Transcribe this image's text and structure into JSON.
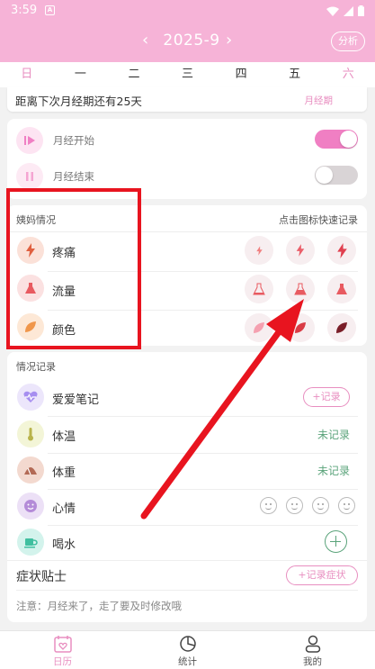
{
  "status_bar": {
    "time": "3:59",
    "app_icon_letter": "A"
  },
  "header": {
    "month": "2025-9",
    "prev": "‹",
    "next": "›",
    "analyze_label": "分析"
  },
  "weekdays": [
    "日",
    "一",
    "二",
    "三",
    "四",
    "五",
    "六"
  ],
  "countdown": {
    "text": "距离下次月经期还有25天",
    "badge": "月经期"
  },
  "period_toggles": [
    {
      "label": "月经开始",
      "on": true
    },
    {
      "label": "月经结束",
      "on": false
    }
  ],
  "aunt_section": {
    "title": "姨妈情况",
    "hint": "点击图标快速记录",
    "rows": [
      {
        "label": "疼痛",
        "icon": "lightning-icon"
      },
      {
        "label": "流量",
        "icon": "flask-icon"
      },
      {
        "label": "颜色",
        "icon": "leaf-icon"
      }
    ]
  },
  "records": {
    "title": "情况记录",
    "items": [
      {
        "label": "爱爱笔记",
        "action": "+记录",
        "icon": "heart-pulse-icon"
      },
      {
        "label": "体温",
        "action": "未记录",
        "icon": "thermometer-icon"
      },
      {
        "label": "体重",
        "action": "未记录",
        "icon": "scale-icon"
      },
      {
        "label": "心情",
        "action": "",
        "icon": "smiley-icon"
      },
      {
        "label": "喝水",
        "action": "",
        "icon": "cup-icon"
      }
    ],
    "symptom_title": "症状贴士",
    "symptom_button": "+记录症状",
    "tip": "注意：月经来了，走了要及时修改哦"
  },
  "tabs": [
    {
      "label": "日历",
      "active": true,
      "icon": "calendar-heart-icon"
    },
    {
      "label": "统计",
      "active": false,
      "icon": "pie-chart-icon"
    },
    {
      "label": "我的",
      "active": false,
      "icon": "user-icon"
    }
  ],
  "colors": {
    "header_pink": "#f6b3d7",
    "accent_pink": "#e88ec0",
    "toggle_on": "#f07fc3",
    "toggle_off": "#d9d4d6",
    "green": "#5aa37a",
    "annotation_red": "#e8141f"
  }
}
